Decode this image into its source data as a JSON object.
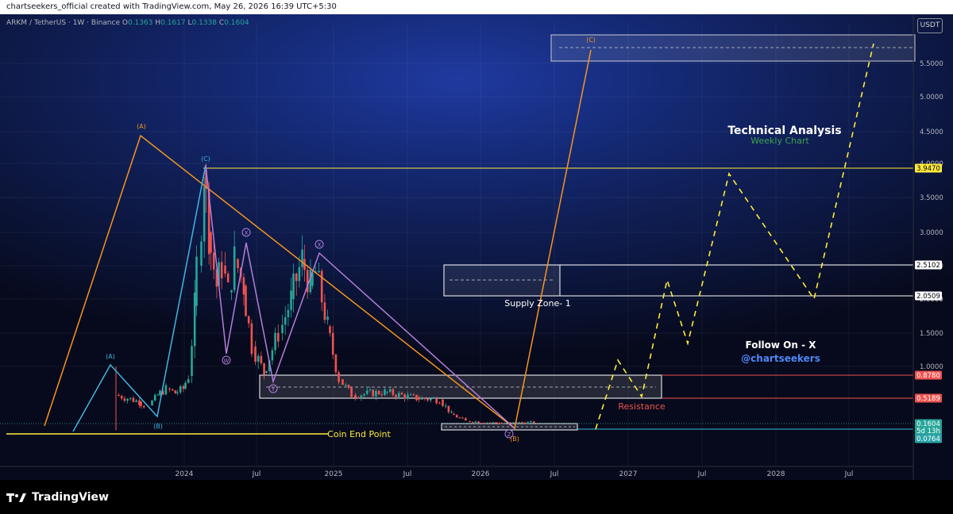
{
  "header": {
    "credit": "chartseekers_official created with TradingView.com, May 26, 2026 16:39 UTC+5:30"
  },
  "symbol": {
    "title": "ARKM / TetherUS · 1W · Binance",
    "o_label": "O",
    "o_val": "0.1363",
    "h_label": "H",
    "h_val": "0.1617",
    "l_label": "L",
    "l_val": "0.1338",
    "c_label": "C",
    "c_val": "0.1604"
  },
  "currency": "USDT",
  "footer": {
    "brand": "TradingView"
  },
  "annotations": {
    "title": "Technical Analysis",
    "subtitle": "Weekly Chart",
    "follow": "Follow On - X",
    "handle": "@chartseekers",
    "supply_zone": "Supply Zone- 1",
    "resistance": "Resistance",
    "coin_end_point": "Coin End Point"
  },
  "colors": {
    "orange": "#f7941d",
    "cyan": "#3fb6e0",
    "purple": "#b57edc",
    "yellow": "#ffeb3b",
    "up": "#26a69a",
    "down": "#ef5350",
    "title_white": "#ffffff",
    "subtitle_green": "#3fa34d",
    "handle_blue": "#4f86f7",
    "resistance_red": "#ef5350"
  },
  "chart_data": {
    "type": "candlestick",
    "symbol": "ARKM / TetherUS",
    "timeframe": "1W",
    "exchange": "Binance",
    "y_axis_ticks": [
      1.0,
      1.5,
      2.0,
      2.5,
      3.0,
      3.5,
      4.0,
      4.5,
      5.0,
      5.5
    ],
    "x_axis_ticks": [
      "2024",
      "Jul",
      "2025",
      "Jul",
      "2026",
      "Jul",
      "2027",
      "Jul",
      "2028",
      "Jul"
    ],
    "price_labels": [
      {
        "value": "3.9470",
        "style": "yellow"
      },
      {
        "value": "2.5102",
        "style": "white"
      },
      {
        "value": "2.0509",
        "style": "white"
      },
      {
        "value": "0.8780",
        "style": "red"
      },
      {
        "value": "0.5189",
        "style": "red"
      },
      {
        "value": "0.1604",
        "style": "green"
      },
      {
        "value": "5d 13h",
        "style": "green"
      },
      {
        "value": "0.0764",
        "style": "teal"
      }
    ],
    "wave_labels": {
      "orange": [
        "(A)",
        "(B)",
        "(C)"
      ],
      "cyan": [
        "(A)",
        "(B)",
        "(C)"
      ],
      "purple": [
        "W",
        "X",
        "Y",
        "X",
        "Z"
      ]
    },
    "reference_levels": [
      3.947,
      2.5102,
      2.0509,
      0.878,
      0.5189,
      0.1604,
      0.0764
    ],
    "zones": [
      {
        "label": "Supply Zone- 1",
        "from": 2.0509,
        "to": 2.5102
      },
      {
        "label": "",
        "from": 0.5189,
        "to": 0.878
      },
      {
        "label": "",
        "from": 0.1,
        "to": 0.16
      },
      {
        "label": "",
        "from": 5.5,
        "to": 5.95
      }
    ]
  }
}
